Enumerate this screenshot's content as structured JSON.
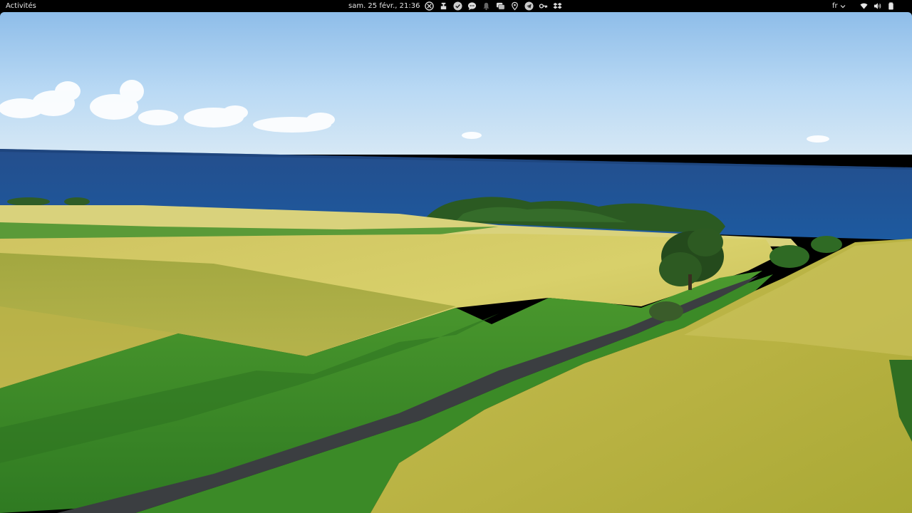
{
  "topbar": {
    "activities_label": "Activités",
    "clock": "sam. 25 févr., 21:36",
    "language": "fr",
    "tray_icons": [
      "crossover-icon",
      "usb-drive-icon",
      "update-check-icon",
      "chat-bubble-icon",
      "notification-bell-icon",
      "messages-icon",
      "location-pin-icon",
      "telegram-icon",
      "key-icon",
      "dropbox-icon"
    ],
    "system_icons": [
      "wifi-icon",
      "volume-icon",
      "battery-icon"
    ]
  },
  "wallpaper": {
    "subject": "rice-terraces-by-the-sea",
    "colors": {
      "sky_top": "#8fbde9",
      "sky_horizon": "#cfe4f6",
      "sea": "#1d5294",
      "field_yellow": "#d6cd63",
      "field_shadow": "#a9a83e",
      "grass": "#3f8e2a",
      "road": "#3a3d40",
      "trees": "#2a5a22"
    }
  }
}
